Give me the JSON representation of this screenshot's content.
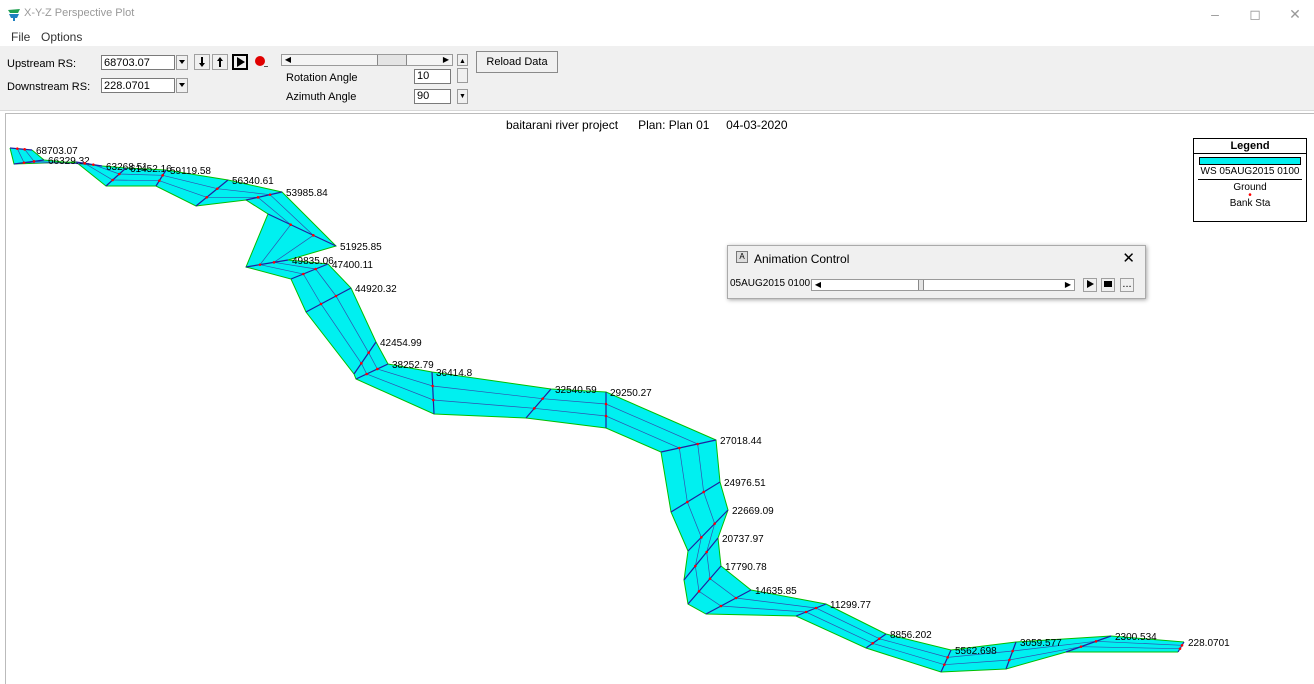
{
  "window": {
    "title": "X-Y-Z Perspective Plot",
    "minimize": "–",
    "restore": "◻",
    "close": "✕"
  },
  "menu": {
    "file": "File",
    "options": "Options"
  },
  "toolbar": {
    "upstream_label": "Upstream RS:",
    "upstream_value": "68703.07",
    "downstream_label": "Downstream RS:",
    "downstream_value": "228.0701",
    "rotation_label": "Rotation Angle",
    "rotation_value": "10",
    "azimuth_label": "Azimuth Angle",
    "azimuth_value": "90",
    "reload_label": "Reload Data",
    "rotation_slider_fraction": 0.4
  },
  "plot": {
    "title": "baitarani river project",
    "plan": "Plan: Plan 01",
    "date": "04-03-2020",
    "station_labels": [
      "68703.07",
      "66329.32",
      "63268.51",
      "61452.16",
      "59119.58",
      "56340.61",
      "53985.84",
      "51925.85",
      "49835.06",
      "47400.11",
      "44920.32",
      "42454.99",
      "38252.79",
      "36414.8",
      "32540.59",
      "29250.27",
      "27018.44",
      "24976.51",
      "22669.09",
      "20737.97",
      "17790.78",
      "14635.85",
      "11299.77",
      "8856.202",
      "5562.698",
      "3059.577",
      "2300.534",
      "228.0701"
    ],
    "colors": {
      "water": "#00f0f0",
      "ground": "#00c000",
      "bank": "#ff0000",
      "section": "#2020a0"
    }
  },
  "legend": {
    "title": "Legend",
    "ws": "WS 05AUG2015 0100",
    "ground": "Ground",
    "bank": "Bank Sta"
  },
  "animation": {
    "title": "Animation Control",
    "close": "✕",
    "time": "05AUG2015 0100",
    "more": "...",
    "position_fraction": 0.4
  }
}
